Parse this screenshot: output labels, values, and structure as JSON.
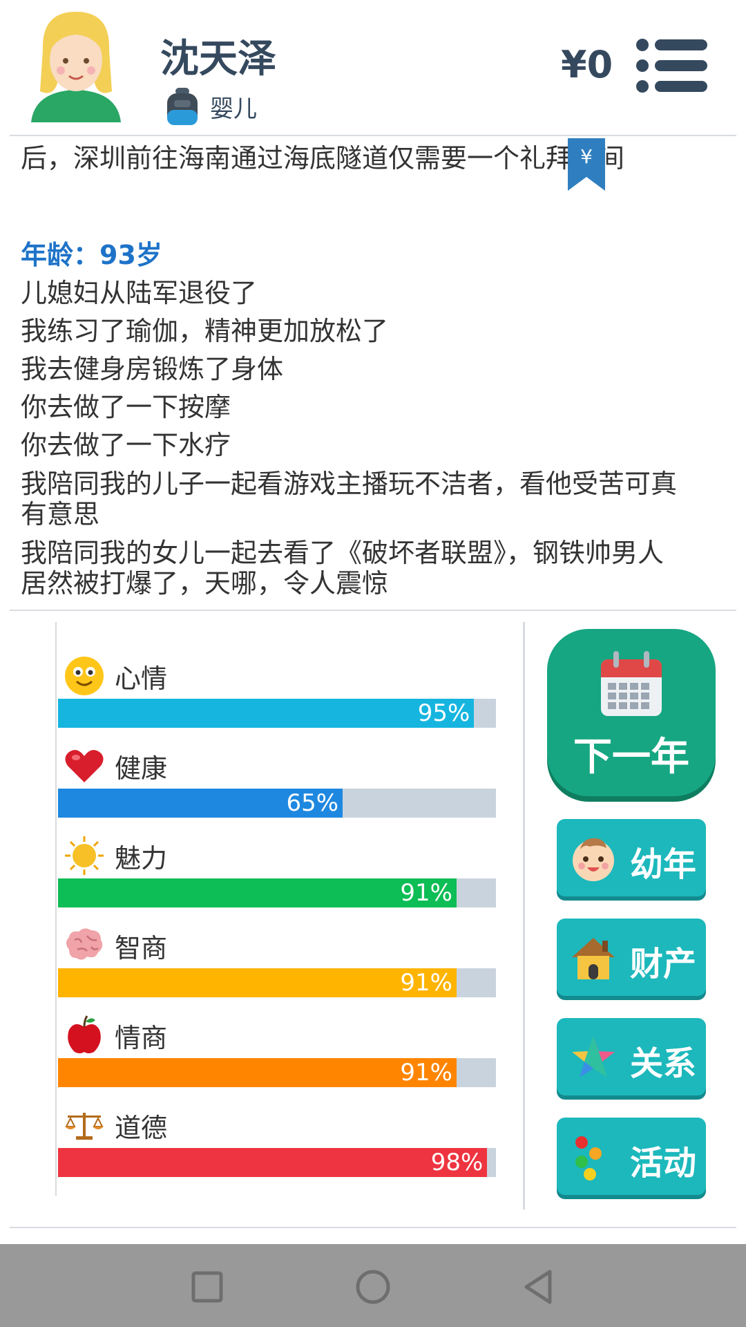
{
  "header": {
    "player_name": "沈天泽",
    "life_stage": "婴儿",
    "money": "¥0"
  },
  "log": {
    "top_line": "后，深圳前往海南通过海底隧道仅需要一个礼拜时间",
    "age_label": "年龄：93岁",
    "events": [
      "儿媳妇从陆军退役了",
      "我练习了瑜伽，精神更加放松了",
      "我去健身房锻炼了身体",
      "你去做了一下按摩",
      "你去做了一下水疗",
      "我陪同我的儿子一起看游戏主播玩不洁者，看他受苦可真",
      "有意思",
      "我陪同我的女儿一起去看了《破坏者联盟》，钢铁帅男人",
      "居然被打爆了，天哪，令人震惊"
    ],
    "bookmark_glyph": "¥"
  },
  "stats": [
    {
      "label": "心情",
      "percent_text": "95%",
      "value": 95,
      "color": "#15b5df",
      "icon": "smiley-icon"
    },
    {
      "label": "健康",
      "percent_text": "65%",
      "value": 65,
      "color": "#1e88e0",
      "icon": "heart-icon"
    },
    {
      "label": "魅力",
      "percent_text": "91%",
      "value": 91,
      "color": "#0dbd55",
      "icon": "sun-icon"
    },
    {
      "label": "智商",
      "percent_text": "91%",
      "value": 91,
      "color": "#ffb400",
      "icon": "brain-icon"
    },
    {
      "label": "情商",
      "percent_text": "91%",
      "value": 91,
      "color": "#ff8500",
      "icon": "apple-icon"
    },
    {
      "label": "道德",
      "percent_text": "98%",
      "value": 98,
      "color": "#ee3440",
      "icon": "scale-icon"
    }
  ],
  "actions": {
    "next_year": "下一年",
    "childhood": "幼年",
    "property": "财产",
    "relations": "关系",
    "activities": "活动"
  },
  "colors": {
    "primary_text": "#35495e",
    "age_blue": "#1e73c8",
    "next_year_green": "#16a682",
    "side_button_teal": "#1cb8bc",
    "bar_track": "#c9d3de"
  }
}
